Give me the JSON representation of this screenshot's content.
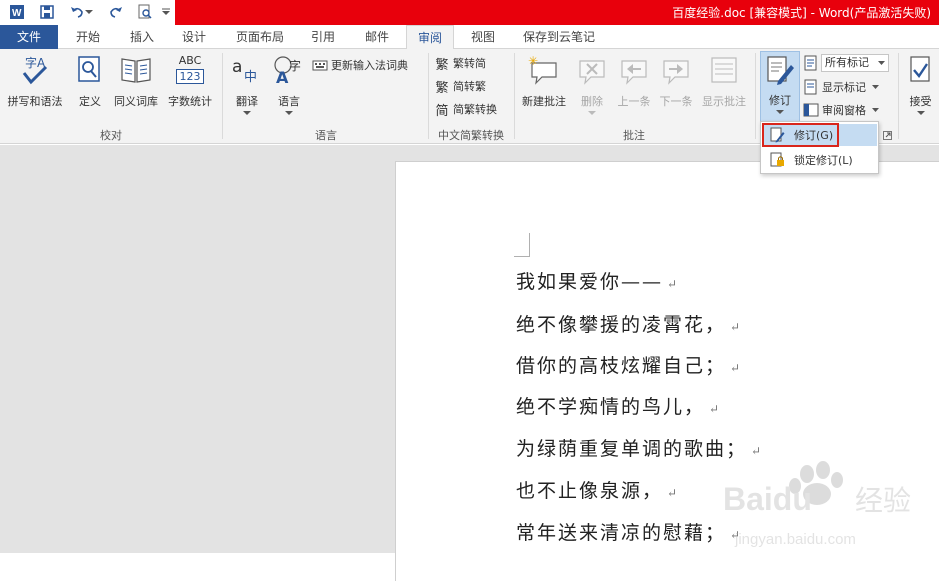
{
  "titlebar": {
    "title": "百度经验.doc [兼容模式] - Word(产品激活失败)",
    "accent": "#e8000c"
  },
  "tabs": {
    "file": "文件",
    "items": [
      "开始",
      "插入",
      "设计",
      "页面布局",
      "引用",
      "邮件",
      "审阅",
      "视图",
      "保存到云笔记"
    ],
    "active": "审阅",
    "file_color": "#2b579a"
  },
  "ribbon": {
    "proofing": {
      "spelling": "拼写和语法",
      "define": "定义",
      "thesaurus": "同义词库",
      "wordcount": "字数统计",
      "wordcount_icon_text": "ABC",
      "wordcount_icon_num": "123",
      "group": "校对"
    },
    "language": {
      "translate": "翻译",
      "language": "语言",
      "update_ime": "更新输入法词典",
      "group": "语言"
    },
    "chinese": {
      "to_trad": "繁转简",
      "to_simp": "简转繁",
      "convert": "简繁转换",
      "group": "中文简繁转换"
    },
    "comments": {
      "new": "新建批注",
      "delete": "删除",
      "prev": "上一条",
      "next": "下一条",
      "show": "显示批注",
      "group": "批注"
    },
    "tracking": {
      "track": "修订",
      "markup_select": "所有标记",
      "show_markup": "显示标记",
      "review_pane": "审阅窗格"
    },
    "changes": {
      "accept": "接受"
    }
  },
  "menu": {
    "items": [
      {
        "label": "修订(G)",
        "highlighted": true
      },
      {
        "label": "锁定修订(L)",
        "highlighted": false
      }
    ]
  },
  "document": {
    "lines": [
      "我如果爱你——",
      "绝不像攀援的凌霄花，",
      "借你的高枝炫耀自己；",
      "绝不学痴情的鸟儿，",
      "为绿荫重复单调的歌曲；",
      "也不止像泉源，",
      "常年送来清凉的慰藉；"
    ],
    "pilcrow": "↵"
  },
  "watermark": {
    "brand": "Baidu",
    "cn": "经验",
    "url": "jingyan.baidu.com"
  }
}
